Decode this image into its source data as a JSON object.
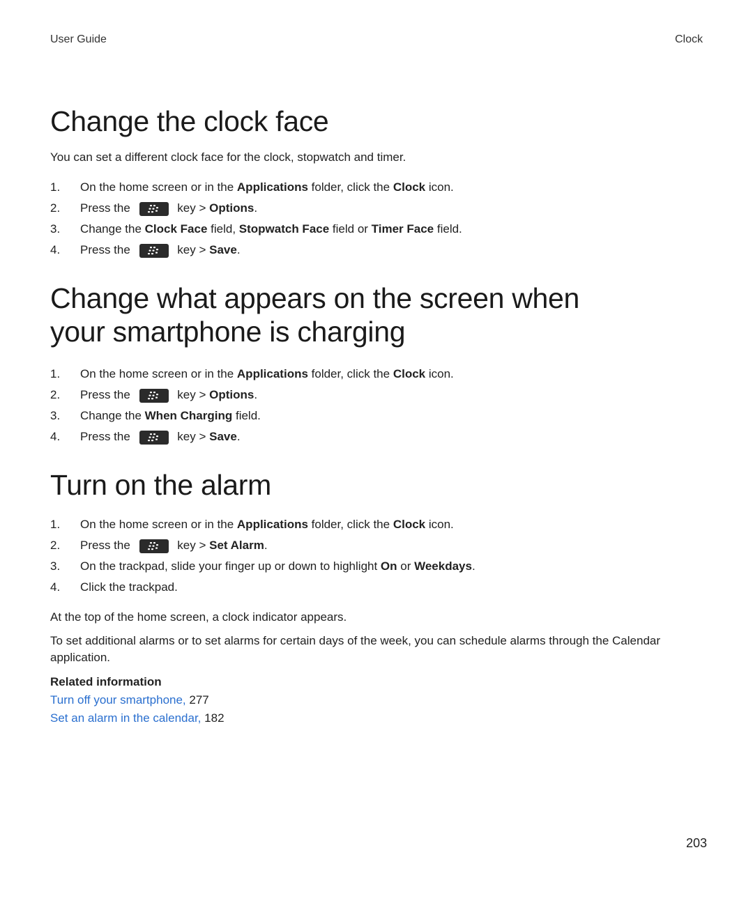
{
  "header": {
    "left": "User Guide",
    "right": "Clock"
  },
  "sections": [
    {
      "title": "Change the clock face",
      "intro": "You can set a different clock face for the clock, stopwatch and timer.",
      "steps": [
        {
          "num": "1.",
          "parts": [
            [
              "t",
              "On the home screen or in the "
            ],
            [
              "b",
              "Applications"
            ],
            [
              "t",
              " folder, click the "
            ],
            [
              "b",
              "Clock"
            ],
            [
              "t",
              " icon."
            ]
          ]
        },
        {
          "num": "2.",
          "parts": [
            [
              "t",
              "Press the "
            ],
            [
              "k",
              "menu-key"
            ],
            [
              "t",
              " key > "
            ],
            [
              "b",
              "Options"
            ],
            [
              "t",
              "."
            ]
          ]
        },
        {
          "num": "3.",
          "parts": [
            [
              "t",
              "Change the "
            ],
            [
              "b",
              "Clock Face"
            ],
            [
              "t",
              " field, "
            ],
            [
              "b",
              "Stopwatch Face"
            ],
            [
              "t",
              " field or "
            ],
            [
              "b",
              "Timer Face"
            ],
            [
              "t",
              " field."
            ]
          ]
        },
        {
          "num": "4.",
          "parts": [
            [
              "t",
              "Press the "
            ],
            [
              "k",
              "menu-key"
            ],
            [
              "t",
              " key > "
            ],
            [
              "b",
              "Save"
            ],
            [
              "t",
              "."
            ]
          ]
        }
      ]
    },
    {
      "title": "Change what appears on the screen when your smartphone is charging",
      "steps": [
        {
          "num": "1.",
          "parts": [
            [
              "t",
              "On the home screen or in the "
            ],
            [
              "b",
              "Applications"
            ],
            [
              "t",
              " folder, click the "
            ],
            [
              "b",
              "Clock"
            ],
            [
              "t",
              " icon."
            ]
          ]
        },
        {
          "num": "2.",
          "parts": [
            [
              "t",
              "Press the "
            ],
            [
              "k",
              "menu-key"
            ],
            [
              "t",
              " key > "
            ],
            [
              "b",
              "Options"
            ],
            [
              "t",
              "."
            ]
          ]
        },
        {
          "num": "3.",
          "parts": [
            [
              "t",
              "Change the "
            ],
            [
              "b",
              "When Charging"
            ],
            [
              "t",
              " field."
            ]
          ]
        },
        {
          "num": "4.",
          "parts": [
            [
              "t",
              "Press the "
            ],
            [
              "k",
              "menu-key"
            ],
            [
              "t",
              " key > "
            ],
            [
              "b",
              "Save"
            ],
            [
              "t",
              "."
            ]
          ]
        }
      ]
    },
    {
      "title": "Turn on the alarm",
      "steps": [
        {
          "num": "1.",
          "parts": [
            [
              "t",
              "On the home screen or in the "
            ],
            [
              "b",
              "Applications"
            ],
            [
              "t",
              " folder, click the "
            ],
            [
              "b",
              "Clock"
            ],
            [
              "t",
              " icon."
            ]
          ]
        },
        {
          "num": "2.",
          "parts": [
            [
              "t",
              "Press the "
            ],
            [
              "k",
              "menu-key"
            ],
            [
              "t",
              " key > "
            ],
            [
              "b",
              "Set Alarm"
            ],
            [
              "t",
              "."
            ]
          ]
        },
        {
          "num": "3.",
          "parts": [
            [
              "t",
              "On the trackpad, slide your finger up or down to highlight "
            ],
            [
              "b",
              "On"
            ],
            [
              "t",
              " or "
            ],
            [
              "b",
              "Weekdays"
            ],
            [
              "t",
              "."
            ]
          ]
        },
        {
          "num": "4.",
          "parts": [
            [
              "t",
              "Click the trackpad."
            ]
          ]
        }
      ],
      "after": [
        "At the top of the home screen, a clock indicator appears.",
        "To set additional alarms or to set alarms for certain days of the week, you can schedule alarms through the Calendar application."
      ],
      "related": {
        "title": "Related information",
        "links": [
          {
            "text": "Turn off your smartphone,",
            "page": "277"
          },
          {
            "text": "Set an alarm in the calendar,",
            "page": "182"
          }
        ]
      }
    }
  ],
  "page_number": "203",
  "colors": {
    "link": "#2a6fcf",
    "key_bg": "#2b2b2b"
  }
}
